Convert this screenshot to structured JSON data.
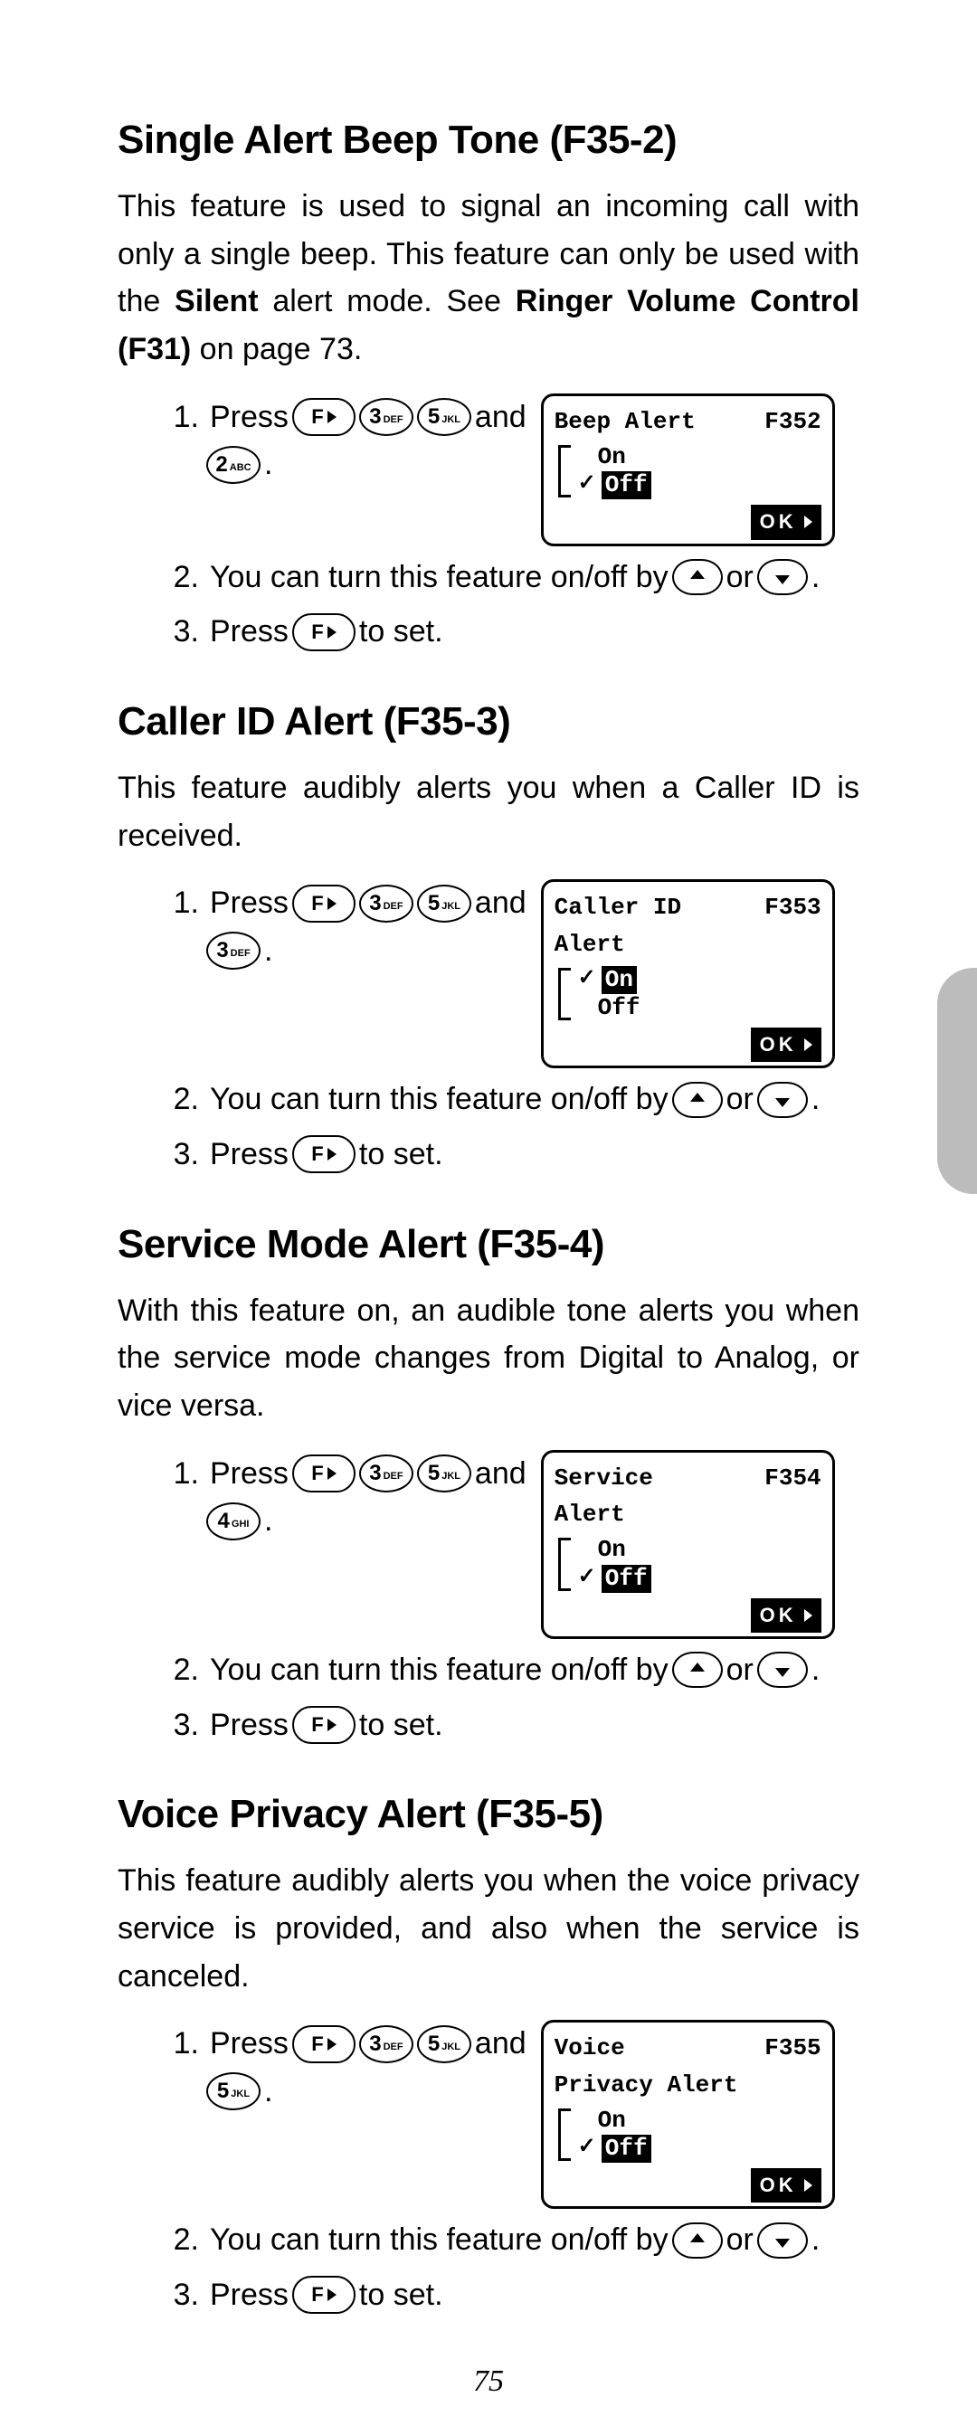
{
  "page_number": "75",
  "sections": [
    {
      "id": "f352",
      "heading": "Single Alert Beep Tone (F35-2)",
      "intro_plain_before": "This feature is used to signal an incoming call with only a single beep. This feature can only be used with the ",
      "intro_bold_1": "Silent",
      "intro_mid": " alert mode. See ",
      "intro_bold_2": "Ringer Volume Control (F31)",
      "intro_after": " on page 73.",
      "step1_press": "Press",
      "step1_and": "and",
      "step1_keys_a": [
        "F",
        "3",
        "5"
      ],
      "step1_keys_b": [
        "2"
      ],
      "screen": {
        "title": "Beep Alert",
        "code": "F352",
        "subtitle": "",
        "options": [
          {
            "label": "On",
            "selected": false,
            "checked": false
          },
          {
            "label": "Off",
            "selected": true,
            "checked": true
          }
        ],
        "ok": "OK"
      },
      "step2_pre": "You can turn this feature on/off by",
      "step2_or": "or",
      "step3_pre": "Press",
      "step3_post": "to set."
    },
    {
      "id": "f353",
      "heading": "Caller ID Alert (F35-3)",
      "intro_plain_before": "This feature audibly alerts you when a Caller ID is received.",
      "intro_bold_1": "",
      "intro_mid": "",
      "intro_bold_2": "",
      "intro_after": "",
      "step1_press": "Press",
      "step1_and": "and",
      "step1_keys_a": [
        "F",
        "3",
        "5"
      ],
      "step1_keys_b": [
        "3"
      ],
      "screen": {
        "title": "Caller ID",
        "code": "F353",
        "subtitle": "Alert",
        "options": [
          {
            "label": "On",
            "selected": true,
            "checked": true
          },
          {
            "label": "Off",
            "selected": false,
            "checked": false
          }
        ],
        "ok": "OK"
      },
      "step2_pre": "You can turn this feature on/off by",
      "step2_or": "or",
      "step3_pre": "Press",
      "step3_post": "to set."
    },
    {
      "id": "f354",
      "heading": "Service Mode Alert (F35-4)",
      "intro_plain_before": "With this feature on, an audible tone alerts you when the service mode changes from Digital to Analog, or vice versa.",
      "intro_bold_1": "",
      "intro_mid": "",
      "intro_bold_2": "",
      "intro_after": "",
      "step1_press": "Press",
      "step1_and": "and",
      "step1_keys_a": [
        "F",
        "3",
        "5"
      ],
      "step1_keys_b": [
        "4"
      ],
      "screen": {
        "title": "Service",
        "code": "F354",
        "subtitle": "Alert",
        "options": [
          {
            "label": "On",
            "selected": false,
            "checked": false
          },
          {
            "label": "Off",
            "selected": true,
            "checked": true
          }
        ],
        "ok": "OK"
      },
      "step2_pre": "You can turn this feature on/off by",
      "step2_or": "or",
      "step3_pre": "Press",
      "step3_post": "to set."
    },
    {
      "id": "f355",
      "heading": "Voice Privacy Alert (F35-5)",
      "intro_plain_before": "This feature audibly alerts you when the voice privacy service is provided, and also when the service is canceled.",
      "intro_bold_1": "",
      "intro_mid": "",
      "intro_bold_2": "",
      "intro_after": "",
      "step1_press": "Press",
      "step1_and": "and",
      "step1_keys_a": [
        "F",
        "3",
        "5"
      ],
      "step1_keys_b": [
        "5"
      ],
      "screen": {
        "title": "Voice",
        "code": "F355",
        "subtitle": "Privacy Alert",
        "options": [
          {
            "label": "On",
            "selected": false,
            "checked": false
          },
          {
            "label": "Off",
            "selected": true,
            "checked": true
          }
        ],
        "ok": "OK"
      },
      "step2_pre": "You can turn this feature on/off by",
      "step2_or": "or",
      "step3_pre": "Press",
      "step3_post": "to set."
    }
  ],
  "key_letters": {
    "2": "ABC",
    "3": "DEF",
    "4": "GHI",
    "5": "JKL"
  }
}
